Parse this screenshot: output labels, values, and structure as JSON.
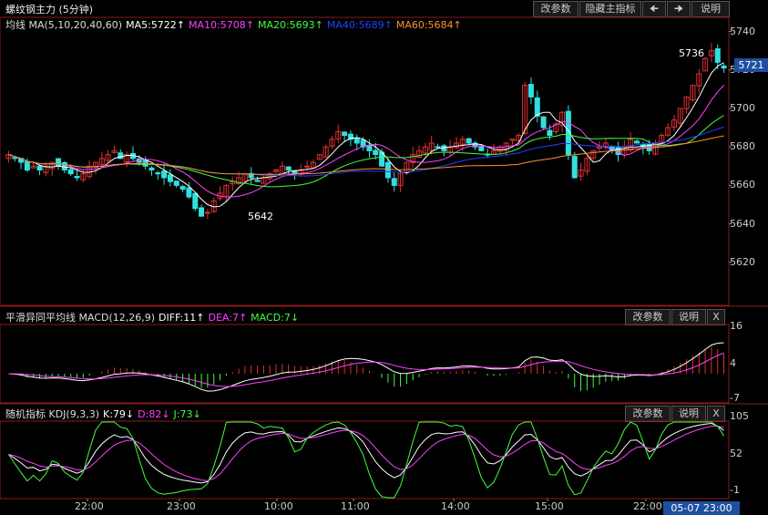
{
  "title": "螺纹钢主力 (5分钟)",
  "colors": {
    "bg": "#000000",
    "up": "#e03030",
    "down": "#30e0e0",
    "ma5": "#ffffff",
    "ma10": "#ff40ff",
    "ma20": "#40ff40",
    "ma40": "#2040ff",
    "ma60": "#ff9030",
    "dif": "#ffffff",
    "dea": "#ff40ff",
    "k": "#ffffff",
    "d": "#ff40ff",
    "j": "#40ff40"
  },
  "toolbar": {
    "modify_params": "改参数",
    "hide_indicator": "隐藏主指标",
    "prev_icon": "arrow-left-icon",
    "next_icon": "arrow-right-icon",
    "explain": "说明"
  },
  "main_panel": {
    "legend": [
      {
        "text": "均线 MA(5,10,20,40,60)",
        "color": "#dddddd"
      },
      {
        "text": "MA5:5722↑",
        "color": "#ffffff"
      },
      {
        "text": "MA10:5708↑",
        "color": "#ff40ff"
      },
      {
        "text": "MA20:5693↑",
        "color": "#40ff40"
      },
      {
        "text": "MA40:5689↑",
        "color": "#2040ff"
      },
      {
        "text": "MA60:5684↑",
        "color": "#ff9030"
      }
    ],
    "y_ticks": [
      "5740",
      "5720",
      "5700",
      "5680",
      "5660",
      "5640",
      "5620"
    ],
    "current_price": "5721",
    "high_label": "5736",
    "low_label": "5642"
  },
  "macd_panel": {
    "legend": [
      {
        "text": "平滑异同平均线 MACD(12,26,9)",
        "color": "#dddddd"
      },
      {
        "text": "DIFF:11↑",
        "color": "#ffffff"
      },
      {
        "text": "DEA:7↑",
        "color": "#ff40ff"
      },
      {
        "text": "MACD:7↓",
        "color": "#40ff40"
      }
    ],
    "y_ticks": [
      "16",
      "4",
      "-7"
    ],
    "modify_params": "改参数",
    "explain": "说明",
    "close": "X"
  },
  "kdj_panel": {
    "legend": [
      {
        "text": "随机指标 KDJ(9,3,3)",
        "color": "#dddddd"
      },
      {
        "text": "K:79↓",
        "color": "#ffffff"
      },
      {
        "text": "D:82↓",
        "color": "#ff40ff"
      },
      {
        "text": "J:73↓",
        "color": "#40ff40"
      }
    ],
    "y_ticks": [
      "105",
      "52",
      "-1"
    ],
    "modify_params": "改参数",
    "explain": "说明",
    "close": "X"
  },
  "x_ticks": [
    "22:00",
    "23:00",
    "10:00",
    "11:00",
    "14:00",
    "15:00",
    "22:00"
  ],
  "current_time": "05-07 23:00",
  "chart_data": {
    "type": "candlestick",
    "title": "螺纹钢主力 (5分钟)",
    "ylim": [
      5600,
      5745
    ],
    "closes": [
      5676,
      5674,
      5672,
      5668,
      5670,
      5668,
      5670,
      5672,
      5670,
      5668,
      5666,
      5664,
      5666,
      5670,
      5672,
      5674,
      5676,
      5678,
      5674,
      5676,
      5674,
      5672,
      5670,
      5668,
      5666,
      5664,
      5662,
      5660,
      5658,
      5654,
      5648,
      5644,
      5646,
      5652,
      5656,
      5660,
      5662,
      5664,
      5666,
      5664,
      5662,
      5664,
      5666,
      5668,
      5670,
      5668,
      5666,
      5668,
      5670,
      5672,
      5676,
      5680,
      5684,
      5688,
      5686,
      5684,
      5682,
      5680,
      5678,
      5676,
      5670,
      5664,
      5660,
      5666,
      5672,
      5676,
      5678,
      5680,
      5682,
      5680,
      5678,
      5680,
      5682,
      5684,
      5682,
      5680,
      5678,
      5676,
      5678,
      5680,
      5682,
      5684,
      5686,
      5712,
      5706,
      5696,
      5690,
      5686,
      5692,
      5698,
      5676,
      5664,
      5668,
      5674,
      5678,
      5680,
      5682,
      5678,
      5676,
      5680,
      5684,
      5682,
      5680,
      5678,
      5682,
      5686,
      5690,
      5694,
      5700,
      5706,
      5712,
      5718,
      5726,
      5730,
      5724,
      5721
    ]
  }
}
